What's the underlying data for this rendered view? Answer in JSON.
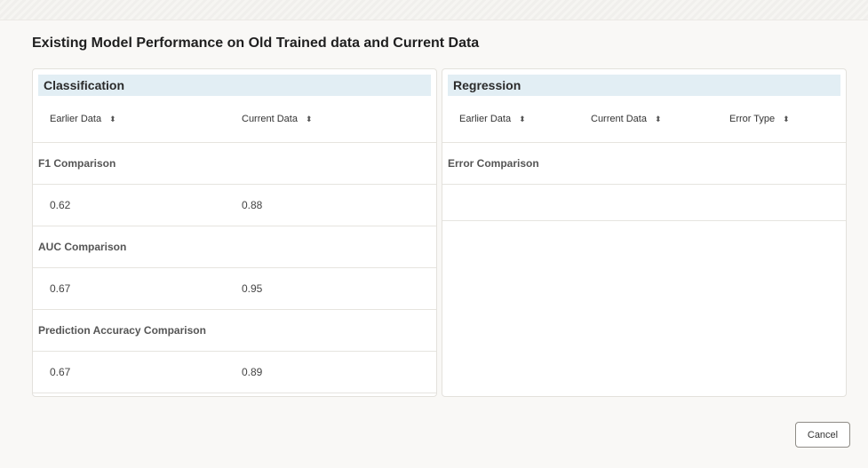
{
  "dialog": {
    "title": "Existing Model Performance on Old Trained data and Current Data",
    "cancel_label": "Cancel"
  },
  "classification": {
    "title": "Classification",
    "columns": [
      "Earlier Data",
      "Current Data"
    ],
    "groups": [
      {
        "label": "F1 Comparison",
        "earlier": "0.62",
        "current": "0.88"
      },
      {
        "label": "AUC Comparison",
        "earlier": "0.67",
        "current": "0.95"
      },
      {
        "label": "Prediction Accuracy Comparison",
        "earlier": "0.67",
        "current": "0.89"
      }
    ]
  },
  "regression": {
    "title": "Regression",
    "columns": [
      "Earlier Data",
      "Current Data",
      "Error Type"
    ],
    "groups": [
      {
        "label": "Error Comparison"
      }
    ]
  },
  "icons": {
    "sort": "sort-arrows-icon"
  }
}
